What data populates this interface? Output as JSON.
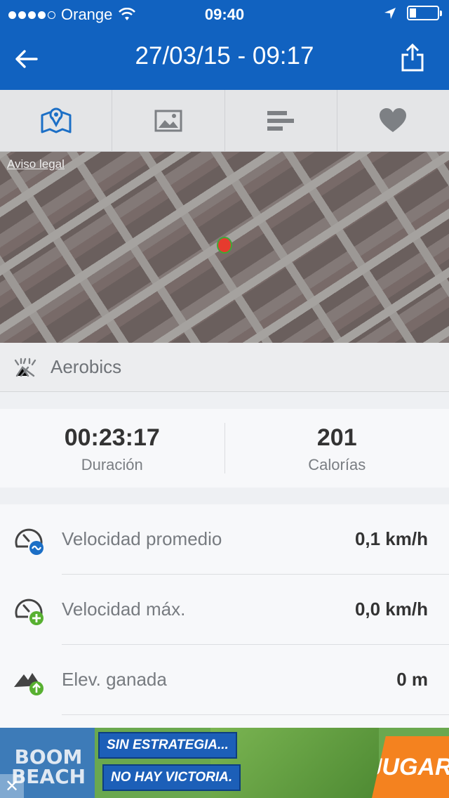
{
  "status_bar": {
    "carrier": "Orange",
    "time": "09:40",
    "signal_bars_filled": 4,
    "signal_bars_total": 5
  },
  "nav": {
    "title": "27/03/15 - 09:17",
    "back_icon": "arrow-left-icon",
    "share_icon": "share-icon"
  },
  "tabs": [
    {
      "icon": "map-icon",
      "active": true
    },
    {
      "icon": "image-icon",
      "active": false
    },
    {
      "icon": "bar-chart-icon",
      "active": false
    },
    {
      "icon": "heart-icon",
      "active": false
    }
  ],
  "map": {
    "legal_link": "Aviso legal"
  },
  "activity": {
    "label": "Aerobics",
    "icon": "aerobics-icon"
  },
  "summary": {
    "duration_value": "00:23:17",
    "duration_label": "Duración",
    "calories_value": "201",
    "calories_label": "Calorías"
  },
  "stats": [
    {
      "label": "Velocidad promedio",
      "value": "0,1 km/h",
      "icon": "speedometer-average-icon"
    },
    {
      "label": "Velocidad máx.",
      "value": "0,0 km/h",
      "icon": "speedometer-max-icon"
    },
    {
      "label": "Elev. ganada",
      "value": "0 m",
      "icon": "elevation-gain-icon"
    }
  ],
  "ad": {
    "logo": "BOOM BEACH",
    "line1": "SIN ESTRATEGIA...",
    "line2": "NO HAY VICTORIA.",
    "cta": "JUGAR",
    "close_label": "✕"
  },
  "colors": {
    "header_blue": "#1162c0",
    "accent_blue": "#1c6fc6",
    "icon_gray": "#7d8084",
    "pin_red": "#e63b2e"
  }
}
